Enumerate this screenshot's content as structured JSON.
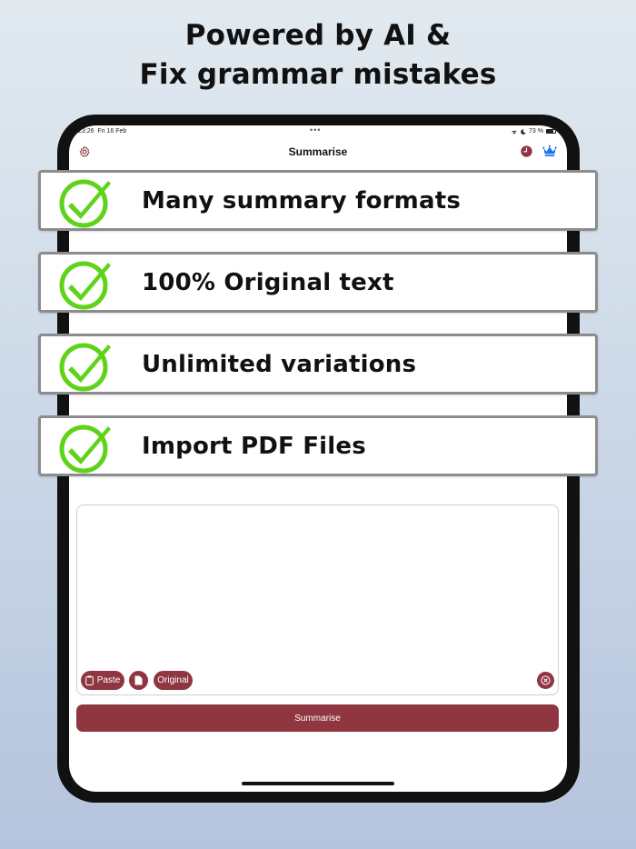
{
  "headline": {
    "line1": "Powered by AI &",
    "line2": "Fix grammar mistakes"
  },
  "status_bar": {
    "time": "23:26",
    "date": "Fri 16 Feb",
    "battery": "73 %",
    "battery_level": 0.73
  },
  "nav": {
    "title": "Summarise",
    "icons": [
      "gear-icon",
      "clock-icon",
      "crown-icon"
    ]
  },
  "features": [
    {
      "label": "Many summary formats",
      "icon": "checkmark-icon"
    },
    {
      "label": "100% Original text",
      "icon": "checkmark-icon"
    },
    {
      "label": "Unlimited variations",
      "icon": "checkmark-icon"
    },
    {
      "label": "Import PDF Files",
      "icon": "checkmark-icon"
    }
  ],
  "editor": {
    "text": "",
    "paste_label": "Paste",
    "mode_label": "Original"
  },
  "summarise_button": "Summarise",
  "colors": {
    "accent": "#8f3641",
    "check_green": "#5fd31a",
    "crown_blue": "#1a73e8"
  }
}
